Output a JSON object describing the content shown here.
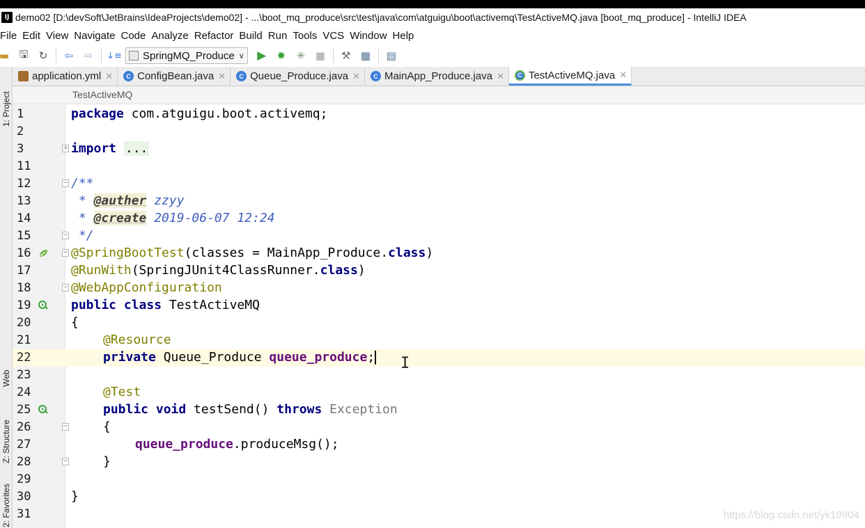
{
  "window": {
    "title": "demo02 [D:\\devSoft\\JetBrains\\IdeaProjects\\demo02] - ...\\boot_mq_produce\\src\\test\\java\\com\\atguigu\\boot\\activemq\\TestActiveMQ.java [boot_mq_produce] - IntelliJ IDEA",
    "app_icon_text": "IJ"
  },
  "menu": [
    "File",
    "Edit",
    "View",
    "Navigate",
    "Code",
    "Analyze",
    "Refactor",
    "Build",
    "Run",
    "Tools",
    "VCS",
    "Window",
    "Help"
  ],
  "toolbar": {
    "run_config": "SpringMQ_Produce"
  },
  "side_tabs": {
    "project": "1: Project",
    "web": "Web",
    "structure": "Z: Structure",
    "favorites": "2: Favorites"
  },
  "tabs": [
    {
      "label": "application.yml",
      "icon": "yml-file-icon",
      "active": false
    },
    {
      "label": "ConfigBean.java",
      "icon": "class-file-icon",
      "active": false
    },
    {
      "label": "Queue_Produce.java",
      "icon": "class-file-icon",
      "active": false
    },
    {
      "label": "MainApp_Produce.java",
      "icon": "spring-app-file-icon",
      "active": false
    },
    {
      "label": "TestActiveMQ.java",
      "icon": "test-class-file-icon",
      "active": true
    }
  ],
  "breadcrumb": "TestActiveMQ",
  "editor": {
    "current_line": 22,
    "line_numbers": [
      "1",
      "2",
      "3",
      "11",
      "12",
      "13",
      "14",
      "15",
      "16",
      "17",
      "18",
      "19",
      "20",
      "21",
      "22",
      "23",
      "24",
      "25",
      "26",
      "27",
      "28",
      "29",
      "30",
      "31"
    ],
    "code": {
      "l1_kw": "package",
      "l1_rest": " com.atguigu.boot.activemq;",
      "l3_kw": "import",
      "l3_fold": "...",
      "l12": "/**",
      "l13_star": " * ",
      "l13_tag": "@auther",
      "l13_val": "zzyy",
      "l14_star": " * ",
      "l14_tag": "@create",
      "l14_val": "2019-06-07 12:24",
      "l15": " */",
      "l16_ann": "@SpringBootTest",
      "l16_mid": "(classes = MainApp_Produce.",
      "l16_kw": "class",
      "l16_end": ")",
      "l17_ann": "@RunWith",
      "l17_mid": "(SpringJUnit4ClassRunner.",
      "l17_kw": "class",
      "l17_end": ")",
      "l18_ann": "@WebAppConfiguration",
      "l19_kw": "public class",
      "l19_rest": " TestActiveMQ",
      "l20": "{",
      "l21_ann": "@Resource",
      "l22_kw": "private",
      "l22_type": " Queue_Produce ",
      "l22_fld": "queue_produce",
      "l22_end": ";",
      "l24_ann": "@Test",
      "l25_kw": "public void",
      "l25_mid": " testSend() ",
      "l25_kw2": "throws",
      "l25_exc": " Exception",
      "l26": "{",
      "l27_fld": "queue_produce",
      "l27_rest": ".produceMsg();",
      "l28": "}",
      "l30": "}"
    }
  },
  "watermark": "https://blog.csdn.net/yk19904"
}
